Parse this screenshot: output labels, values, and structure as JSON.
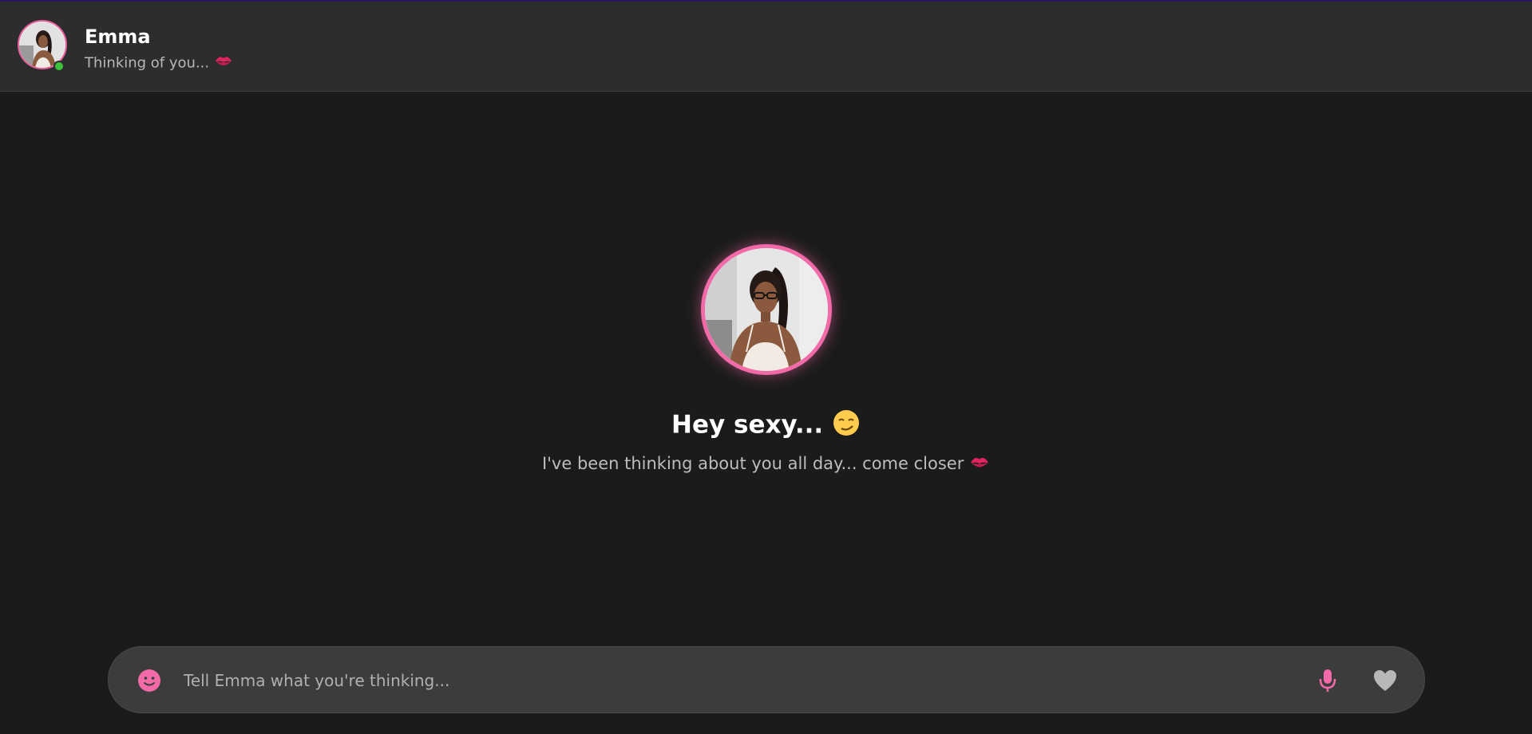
{
  "app": {
    "accent_color": "#f26aa8",
    "background_color": "#1b1b1b",
    "header_color": "#2d2d2d",
    "online_color": "#3cc13b"
  },
  "header": {
    "name": "Emma",
    "status": "Thinking of you...",
    "status_icon": "kiss-mark-icon",
    "avatar_icon": "avatar-photo",
    "online_indicator": "online-dot"
  },
  "hero": {
    "avatar_icon": "profile-photo",
    "greeting": "Hey sexy...",
    "greeting_icon": "smirking-face-icon",
    "subtitle": "I've been thinking about you all day... come closer",
    "subtitle_icon": "kiss-mark-icon"
  },
  "composer": {
    "placeholder": "Tell Emma what you're thinking...",
    "value": "",
    "emoji_icon": "smiley-face-icon",
    "mic_icon": "microphone-icon",
    "heart_icon": "heart-icon"
  }
}
